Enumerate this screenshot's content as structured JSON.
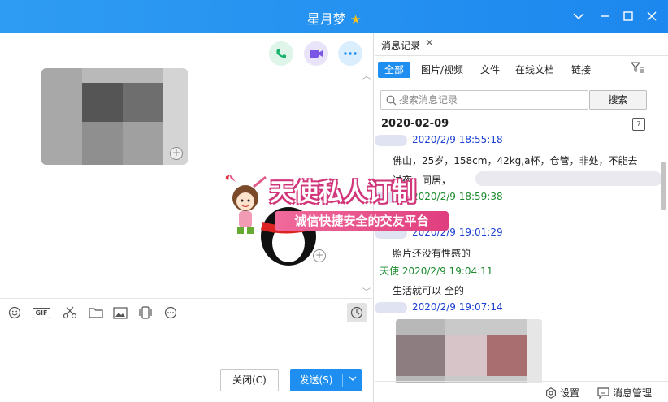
{
  "window": {
    "title": "星月梦",
    "title_star": "★"
  },
  "chat": {
    "toolbar_icons": [
      "emoji-icon",
      "gif-icon",
      "scissors-icon",
      "folder-icon",
      "image-icon",
      "shake-icon",
      "more-icon"
    ],
    "gif_label": "GIF",
    "buttons": {
      "close": "关闭(C)",
      "send": "发送(S)"
    }
  },
  "history": {
    "tab_title": "消息记录",
    "filters": [
      "全部",
      "图片/视频",
      "文件",
      "在线文档",
      "链接"
    ],
    "search_placeholder": "搜索消息记录",
    "search_button": "搜索",
    "date": "2020-02-09",
    "calendar_day": "7",
    "messages": [
      {
        "sender": "",
        "time": "2020/2/9 18:55:18",
        "color": "blue",
        "text": "佛山，25岁，158cm，42kg,a杯，仓管，非处，不能去"
      },
      {
        "sender": "",
        "time": "",
        "color": "",
        "text": "过夜，同居，"
      },
      {
        "sender": "",
        "time": "2020/2/9 18:59:38",
        "color": "green",
        "text": ""
      },
      {
        "sender": "",
        "time": "2020/2/9 19:01:29",
        "color": "blue",
        "text": "照片还没有性感的"
      },
      {
        "sender": "天使",
        "time": "2020/2/9 19:04:11",
        "color": "green",
        "text": "生活就可以 全的"
      },
      {
        "sender": "",
        "time": "2020/2/9 19:07:14",
        "color": "blue",
        "text": ""
      }
    ],
    "bottom": {
      "settings": "设置",
      "manage": "消息管理"
    }
  },
  "overlay": {
    "line1": "天使私人订制",
    "line2": "诚信快捷安全的交友平台"
  },
  "colors": {
    "titlebar": "#1c87ee",
    "accent": "#1e8ff0",
    "blue_time": "#1a3fd1",
    "green_time": "#1c8a2d"
  }
}
